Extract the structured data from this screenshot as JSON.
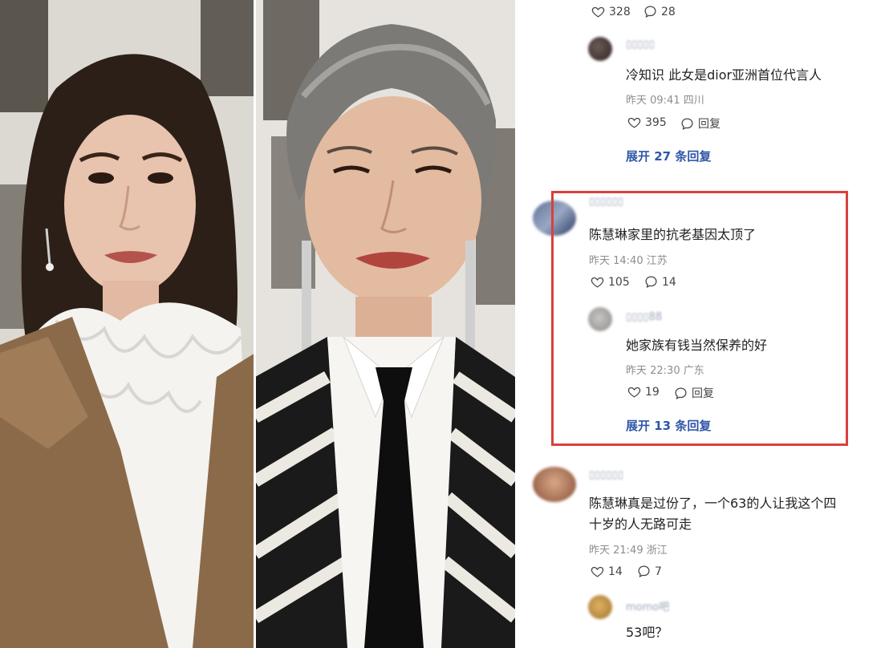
{
  "comments": [
    {
      "type": "reply",
      "likes": "328",
      "replies": "28"
    },
    {
      "type": "reply",
      "username": "▯▯▯▯▯",
      "text": "冷知识 此女是dior亚洲首位代言人",
      "date": "昨天 09:41",
      "location": "四川",
      "likes": "395",
      "reply_label": "回复",
      "expand": "展开 27 条回复"
    },
    {
      "type": "top",
      "username": "▯▯▯▯▯▯",
      "text": "陈慧琳家里的抗老基因太顶了",
      "date": "昨天 14:40",
      "location": "江苏",
      "likes": "105",
      "replies": "14"
    },
    {
      "type": "reply",
      "username": "▯▯▯▯88",
      "text": "她家族有钱当然保养的好",
      "date": "昨天 22:30",
      "location": "广东",
      "likes": "19",
      "reply_label": "回复",
      "expand": "展开 13 条回复"
    },
    {
      "type": "top",
      "username": "▯▯▯▯▯▯",
      "text_line1": "陈慧琳真是过份了，一个63的人让我这个四",
      "text_line2": "十岁的人无路可走",
      "date": "昨天 21:49",
      "location": "浙江",
      "likes": "14",
      "replies": "7"
    },
    {
      "type": "reply",
      "username": "momo吧",
      "text": "53吧？"
    }
  ],
  "colors": {
    "highlight_border": "#d9413c",
    "expand_link": "#2f56a8",
    "meta_text": "#8d8d8d"
  }
}
